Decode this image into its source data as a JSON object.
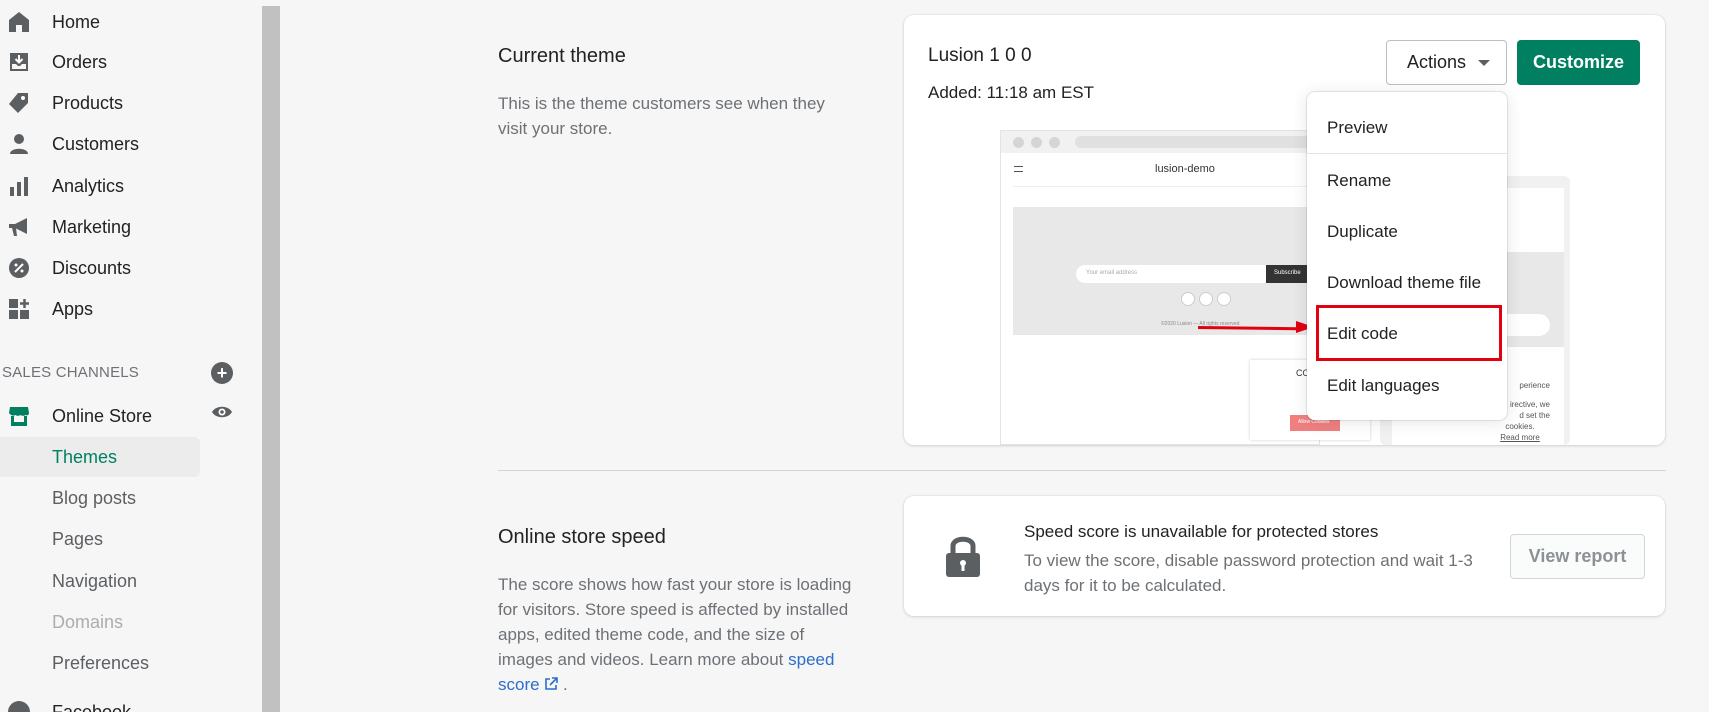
{
  "sidebar": {
    "nav": [
      {
        "label": "Home",
        "icon": "home-icon"
      },
      {
        "label": "Orders",
        "icon": "orders-icon"
      },
      {
        "label": "Products",
        "icon": "tag-icon"
      },
      {
        "label": "Customers",
        "icon": "person-icon"
      },
      {
        "label": "Analytics",
        "icon": "bar-chart-icon"
      },
      {
        "label": "Marketing",
        "icon": "megaphone-icon"
      },
      {
        "label": "Discounts",
        "icon": "discount-icon"
      },
      {
        "label": "Apps",
        "icon": "apps-icon"
      }
    ],
    "sales_channels_heading": "SALES CHANNELS",
    "online_store": {
      "label": "Online Store",
      "icon": "store-icon"
    },
    "sub_items": [
      {
        "label": "Themes",
        "state": "active"
      },
      {
        "label": "Blog posts",
        "state": "normal"
      },
      {
        "label": "Pages",
        "state": "normal"
      },
      {
        "label": "Navigation",
        "state": "normal"
      },
      {
        "label": "Domains",
        "state": "muted"
      },
      {
        "label": "Preferences",
        "state": "normal"
      }
    ],
    "partial_item": "Facebook"
  },
  "current_theme": {
    "section_title": "Current theme",
    "section_desc": "This is the theme customers see when they visit your store.",
    "theme_name": "Lusion 1 0 0",
    "added": "Added: 11:18 am EST",
    "actions_label": "Actions",
    "customize_label": "Customize",
    "preview": {
      "site_name": "lusion-demo",
      "email_placeholder": "Your email address",
      "subscribe": "Subscribe",
      "copyright": "©2020 Lusion — All rights reserved",
      "cookie_title": "CO",
      "cookie_button": "Allow Cookies",
      "mobile_text_1": "perience",
      "mobile_text_2": "irective, we",
      "mobile_text_3": "d set the",
      "mobile_text_4": "cookies.",
      "mobile_read_more": "Read more"
    },
    "dropdown": [
      {
        "label": "Preview",
        "highlighted": false
      },
      {
        "label": "Rename",
        "highlighted": false
      },
      {
        "label": "Duplicate",
        "highlighted": false
      },
      {
        "label": "Download theme file",
        "highlighted": false
      },
      {
        "label": "Edit code",
        "highlighted": true
      },
      {
        "label": "Edit languages",
        "highlighted": false
      }
    ]
  },
  "speed": {
    "section_title": "Online store speed",
    "section_desc": "The score shows how fast your store is loading for visitors. Store speed is affected by installed apps, edited theme code, and the size of images and videos. Learn more about",
    "link_text": "speed score",
    "link_suffix": ".",
    "card_title": "Speed score is unavailable for protected stores",
    "card_desc": "To view the score, disable password protection and wait 1-3 days for it to be calculated.",
    "view_report_label": "View report"
  },
  "colors": {
    "brand_green": "#008060",
    "annotation_red": "#e3000f",
    "link_blue": "#2c6ecb"
  }
}
